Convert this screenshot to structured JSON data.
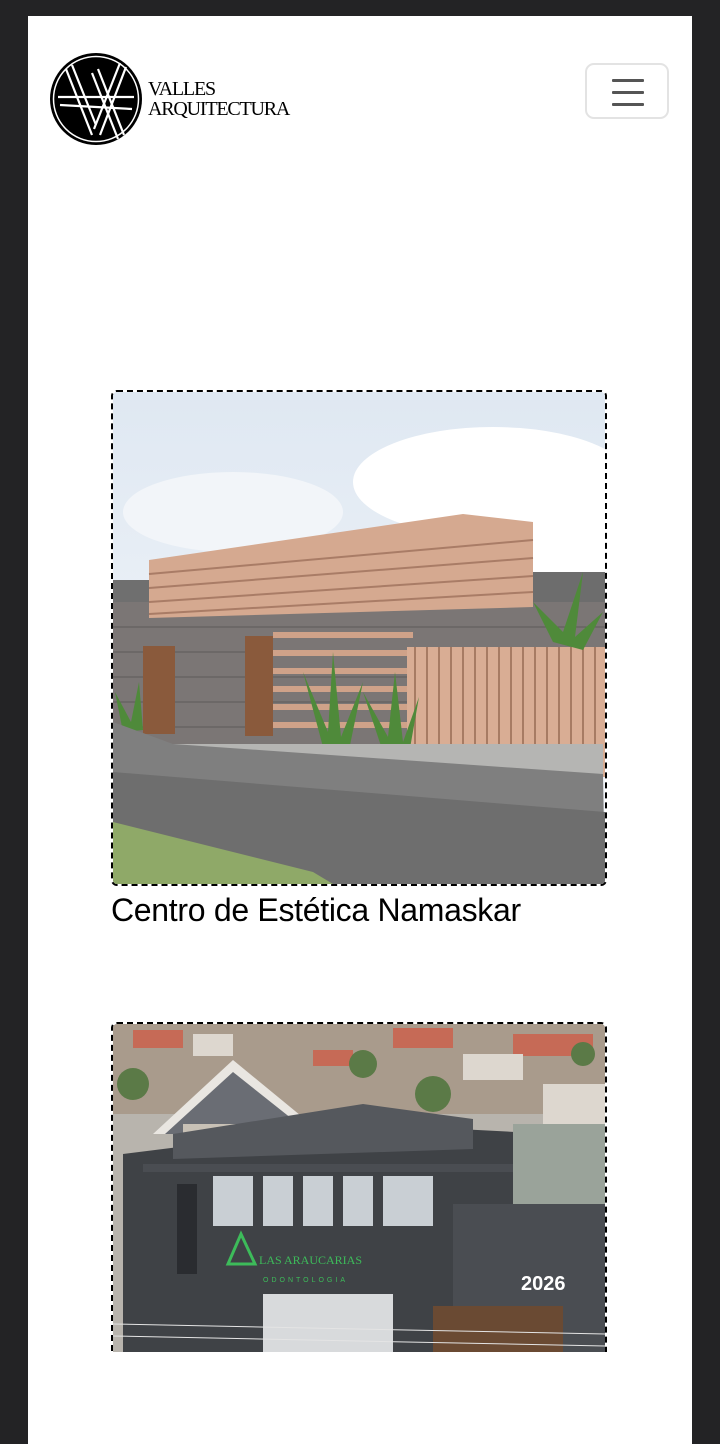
{
  "brand": {
    "name_line1": "VALLES",
    "name_line2": "ARQUITECTURA",
    "monogram": "VA"
  },
  "nav": {
    "menu_icon": "hamburger-icon"
  },
  "projects": [
    {
      "title": "Centro de Estética Namaskar",
      "image": "render of a single-story house with horizontal wood-clad canopy, grey brick wall and wooden slat fence"
    },
    {
      "title": "",
      "image": "aerial photo of a dark grey two-story dental clinic building",
      "sign_text": "LAS ARAUCARIAS",
      "sign_subtext": "ODONTOLOGIA",
      "building_number": "2026"
    }
  ],
  "colors": {
    "frame": "#232325",
    "page": "#ffffff",
    "text": "#000000",
    "menu_border": "#e3e3e3"
  }
}
